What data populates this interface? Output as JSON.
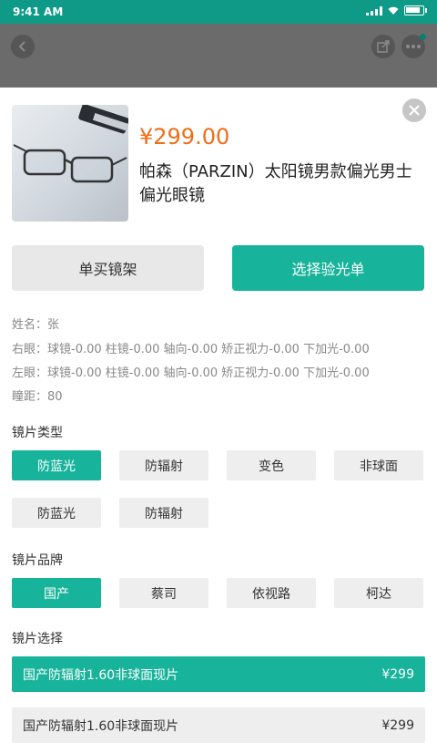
{
  "status_bar": {
    "time": "9:41 AM",
    "battery_level": 0.9
  },
  "header_icons": {
    "back": "chevron-left-icon",
    "share": "share-icon",
    "more": "more-icon"
  },
  "product": {
    "price": "¥299.00",
    "title": "帕森（PARZIN）太阳镜男款偏光男士偏光眼镜"
  },
  "actions": {
    "buy_frame": "单买镜架",
    "choose_prescription": "选择验光单"
  },
  "prescription": {
    "name": "姓名：张",
    "right_eye": "右眼：球镜-0.00  柱镜-0.00  轴向-0.00  矫正视力-0.00  下加光-0.00",
    "left_eye": "左眼：球镜-0.00  柱镜-0.00  轴向-0.00  矫正视力-0.00  下加光-0.00",
    "pd": "瞳距：80"
  },
  "lens_type": {
    "title": "镜片类型",
    "options": [
      "防蓝光",
      "防辐射",
      "变色",
      "非球面",
      "防蓝光",
      "防辐射"
    ],
    "selected_index": 0
  },
  "lens_brand": {
    "title": "镜片品牌",
    "options": [
      "国产",
      "蔡司",
      "依视路",
      "柯达"
    ],
    "selected_index": 0
  },
  "lens_selection": {
    "title": "镜片选择",
    "items": [
      {
        "name": "国产防辐射1.60非球面现片",
        "price": "¥299",
        "selected": true
      },
      {
        "name": "国产防辐射1.60非球面现片",
        "price": "¥299",
        "selected": false
      }
    ]
  },
  "colors": {
    "accent": "#17b39a",
    "price": "#f26c17",
    "status_bar": "#0e9a86"
  }
}
